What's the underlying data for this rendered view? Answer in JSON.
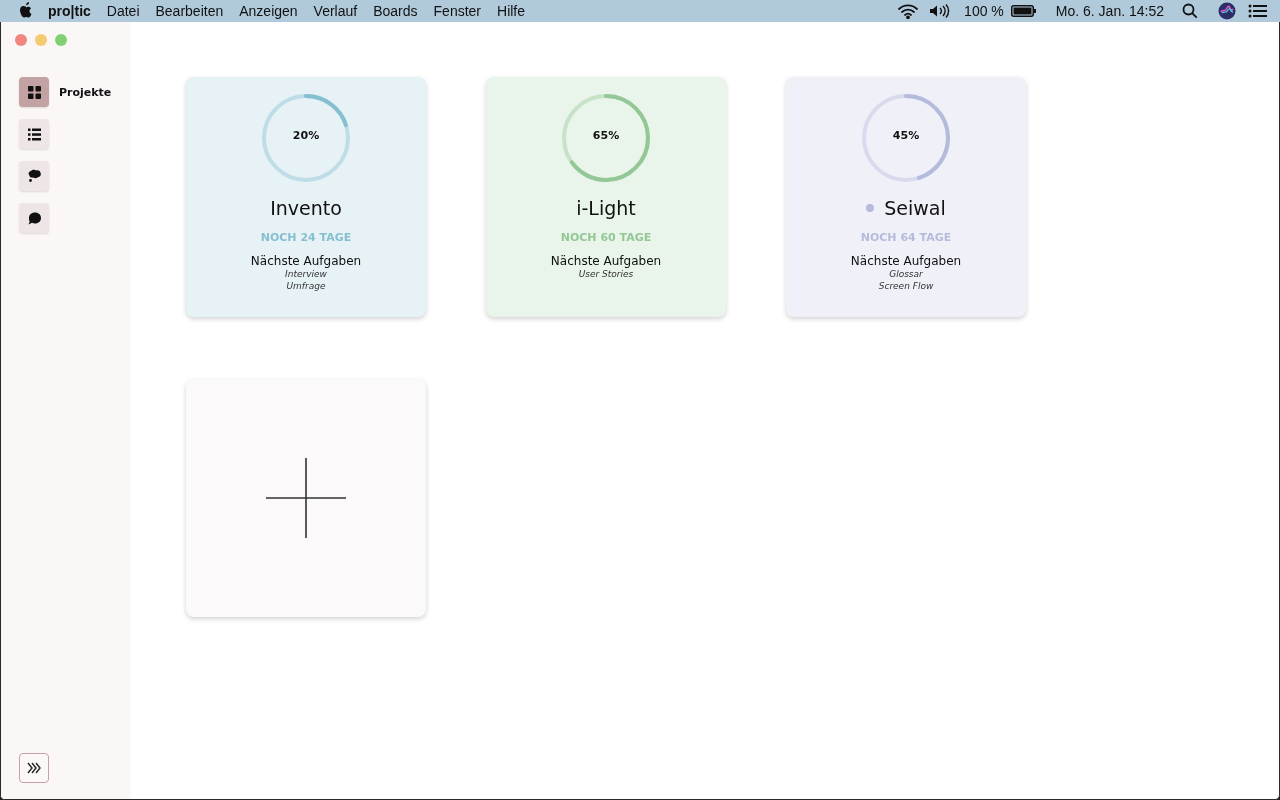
{
  "menu_bar": {
    "app_name": "pro|tic",
    "menus": [
      "Datei",
      "Bearbeiten",
      "Anzeigen",
      "Verlauf",
      "Boards",
      "Fenster",
      "Hilfe"
    ],
    "battery": "100 %",
    "clock": "Mo. 6. Jan.  14:52"
  },
  "sidebar": {
    "items": [
      {
        "kind": "grid",
        "label": "Projekte",
        "selected": true
      },
      {
        "kind": "list",
        "selected": false
      },
      {
        "kind": "thought",
        "selected": false
      },
      {
        "kind": "chat",
        "selected": false
      }
    ]
  },
  "projects": [
    {
      "name": "Invento",
      "progress": "20%",
      "level": 0.2,
      "color": "#85bfd0",
      "remaining": "NOCH 24 TAGE",
      "marked": false,
      "tasks_heading": "Nächste Aufgaben",
      "tasks": [
        "Interview",
        "Umfrage"
      ]
    },
    {
      "name": "i-Light",
      "progress": "65%",
      "level": 0.65,
      "color": "#93c795",
      "remaining": "NOCH 60 TAGE",
      "marked": false,
      "tasks_heading": "Nächste Aufgaben",
      "tasks": [
        "User Stories"
      ]
    },
    {
      "name": "Seiwal",
      "progress": "45%",
      "level": 0.45,
      "color": "#b4bbdb",
      "remaining": "NOCH 64 TAGE",
      "marked": true,
      "tasks_heading": "Nächste Aufgaben",
      "tasks": [
        "Glossar",
        "Screen Flow"
      ]
    }
  ]
}
